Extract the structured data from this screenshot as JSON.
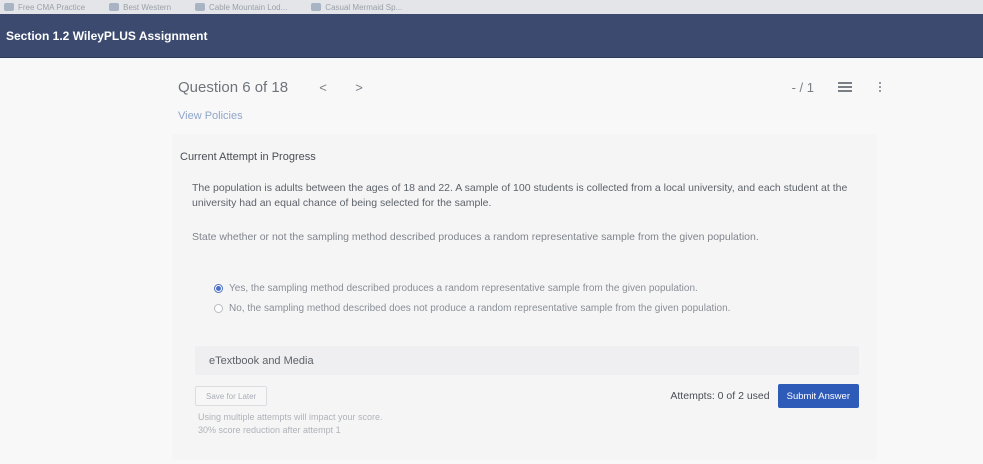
{
  "bookmarks": [
    {
      "label": "Free CMA Practice"
    },
    {
      "label": "Best Western"
    },
    {
      "label": "Cable Mountain Lod..."
    },
    {
      "label": "Casual Mermaid Sp..."
    }
  ],
  "header": {
    "title": "Section 1.2 WileyPLUS Assignment"
  },
  "question_nav": {
    "title": "Question 6 of 18",
    "prev": "<",
    "next": ">",
    "score": "- / 1"
  },
  "view_policies": "View Policies",
  "attempt": {
    "status_label": "Current Attempt in Progress",
    "question_text": "The population is adults between the ages of 18 and 22. A sample of 100 students is collected from a local university, and each student at the university had an equal chance of being selected for the sample.",
    "prompt": "State whether or not the sampling method described produces a random representative sample from the given population.",
    "options": [
      {
        "label": "Yes, the sampling method described produces a random representative sample from the given population.",
        "selected": true
      },
      {
        "label": "No, the sampling method described does not produce a random representative sample from the given population.",
        "selected": false
      }
    ],
    "etextbook_label": "eTextbook and Media",
    "save_label": "Save for Later",
    "attempts_text": "Attempts: 0 of 2 used",
    "submit_label": "Submit Answer",
    "note_1": "Using multiple attempts will impact your score.",
    "note_2": "30% score reduction after attempt 1"
  },
  "colors": {
    "header_bg": "#3b4a6e",
    "submit_bg": "#2f5bb8",
    "link": "#8fa6c8"
  }
}
